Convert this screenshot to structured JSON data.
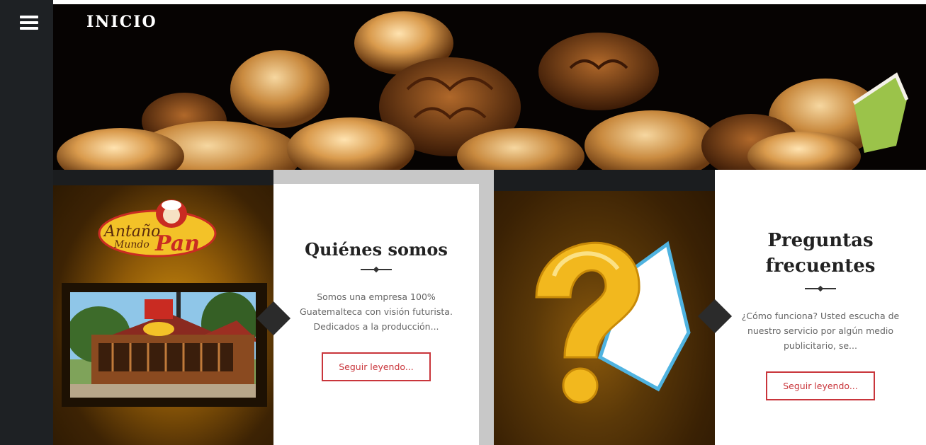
{
  "header": {
    "title": "INICIO",
    "menu_icon": "hamburger-menu-icon"
  },
  "colors": {
    "sidebar": "#1e2124",
    "accent": "#c9353b",
    "card_background": "#ffffff",
    "tile_brown": "#3d2304"
  },
  "cards": [
    {
      "logo_line1": "Antaño",
      "logo_line2": "Mundo",
      "logo_line3": "Pan",
      "title": "Quiénes somos",
      "text": "Somos una empresa 100% Guatemalteca con visión futurista. Dedicados a la producción...",
      "button": "Seguir leyendo..."
    },
    {
      "image_icon": "question-mark-icon",
      "title": "Preguntas frecuentes",
      "text": "¿Cómo funciona? Usted escucha de nuestro servicio por algún medio publicitario, se...",
      "button": "Seguir leyendo..."
    }
  ]
}
